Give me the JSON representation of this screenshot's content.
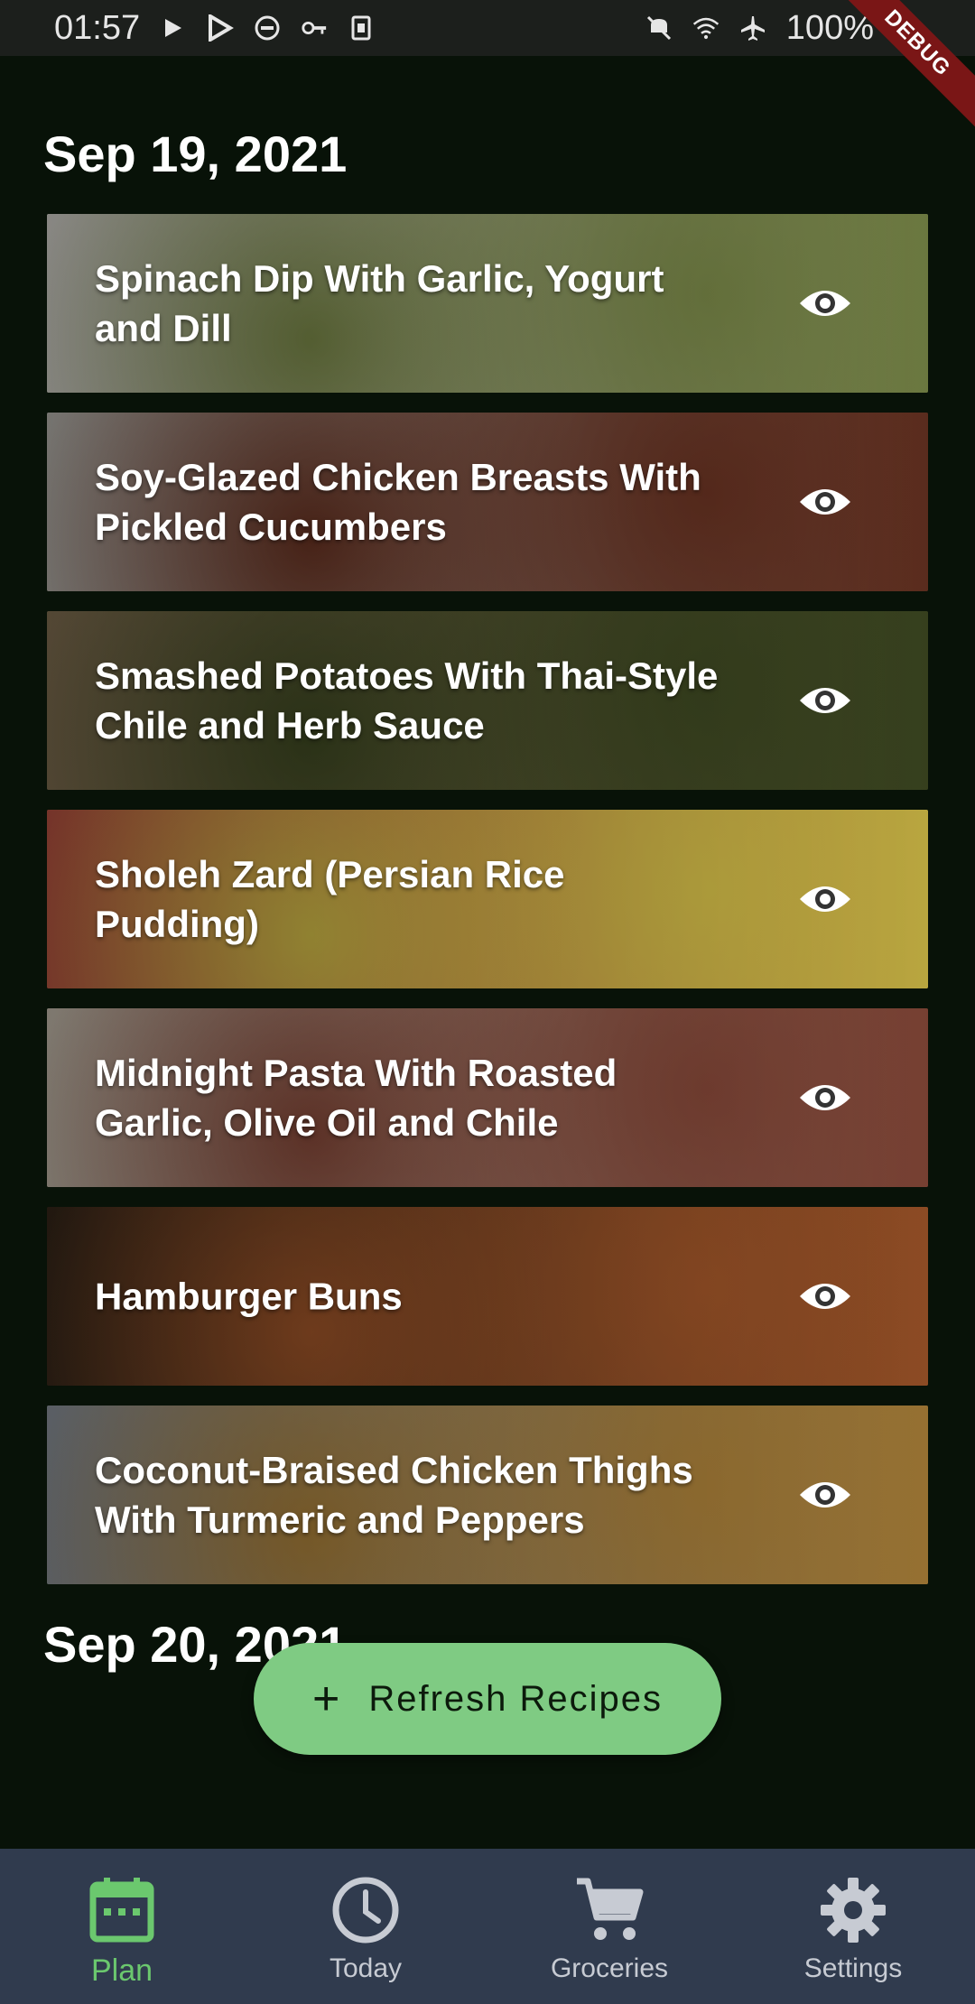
{
  "status_bar": {
    "time": "01:57",
    "battery": "100%",
    "debug_label": "DEBUG"
  },
  "sections": [
    {
      "date": "Sep 19, 2021"
    },
    {
      "date": "Sep 20, 2021"
    }
  ],
  "recipes": [
    {
      "title": "Spinach Dip With Garlic, Yogurt and Dill",
      "image_colors": [
        "#e9e7e0",
        "#7d8c4a"
      ]
    },
    {
      "title": "Soy-Glazed Chicken Breasts With Pickled Cucumbers",
      "image_colors": [
        "#c9c6bf",
        "#6a3322"
      ]
    },
    {
      "title": "Smashed Potatoes With Thai-Style Chile and Herb Sauce",
      "image_colors": [
        "#8e7a5a",
        "#3f4a22"
      ]
    },
    {
      "title": "Sholeh Zard (Persian Rice Pudding)",
      "image_colors": [
        "#c95a48",
        "#d9c34a"
      ]
    },
    {
      "title": "Midnight Pasta With Roasted Garlic, Olive Oil and Chile",
      "image_colors": [
        "#d9cfbf",
        "#8a4a3a"
      ]
    },
    {
      "title": "Hamburger Buns",
      "image_colors": [
        "#3a2a1c",
        "#a5582a"
      ]
    },
    {
      "title": "Coconut-Braised Chicken Thighs With Turmeric and Peppers",
      "image_colors": [
        "#9aa2ac",
        "#b0843a"
      ]
    }
  ],
  "fab": {
    "label": "Refresh Recipes"
  },
  "bottom_nav": {
    "items": [
      {
        "label": "Plan",
        "icon": "calendar-icon",
        "active": true
      },
      {
        "label": "Today",
        "icon": "clock-icon",
        "active": false
      },
      {
        "label": "Groceries",
        "icon": "cart-icon",
        "active": false
      },
      {
        "label": "Settings",
        "icon": "gear-icon",
        "active": false
      }
    ]
  },
  "colors": {
    "background": "#081208",
    "accent": "#6bc86e",
    "fab": "#7fcb83",
    "nav_background": "#303b4e"
  }
}
